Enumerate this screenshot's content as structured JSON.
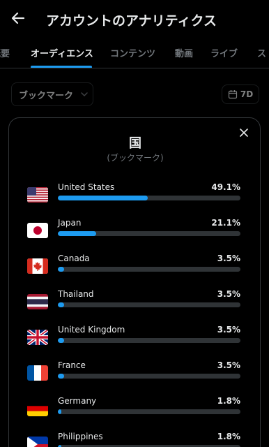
{
  "header": {
    "title": "アカウントのアナリティクス",
    "back_icon": "arrow-left-icon"
  },
  "tabs": [
    "概要",
    "オーディエンス",
    "コンテンツ",
    "動画",
    "ライブ",
    "ス"
  ],
  "active_tab": "オーディエンス",
  "filter": {
    "label": "ブックマーク",
    "icon": "chevron-down-icon"
  },
  "range": {
    "label": "7D",
    "icon": "calendar-icon"
  },
  "modal": {
    "title": "国",
    "subtitle": "(ブックマーク)",
    "close_icon": "close-icon",
    "countries": [
      {
        "name": "United States",
        "percent": "49.1%",
        "share": 0.491,
        "flag": "us-flag-icon"
      },
      {
        "name": "Japan",
        "percent": "21.1%",
        "share": 0.211,
        "flag": "jp-flag-icon"
      },
      {
        "name": "Canada",
        "percent": "3.5%",
        "share": 0.035,
        "flag": "ca-flag-icon"
      },
      {
        "name": "Thailand",
        "percent": "3.5%",
        "share": 0.035,
        "flag": "th-flag-icon"
      },
      {
        "name": "United Kingdom",
        "percent": "3.5%",
        "share": 0.035,
        "flag": "gb-flag-icon"
      },
      {
        "name": "France",
        "percent": "3.5%",
        "share": 0.035,
        "flag": "fr-flag-icon"
      },
      {
        "name": "Germany",
        "percent": "1.8%",
        "share": 0.018,
        "flag": "de-flag-icon"
      },
      {
        "name": "Philippines",
        "percent": "1.8%",
        "share": 0.018,
        "flag": "ph-flag-icon"
      }
    ]
  },
  "colors": {
    "accent": "#1d9bf0",
    "track": "#2f3336",
    "background": "#000000",
    "text": "#e7e9ea",
    "muted": "#71767b"
  }
}
